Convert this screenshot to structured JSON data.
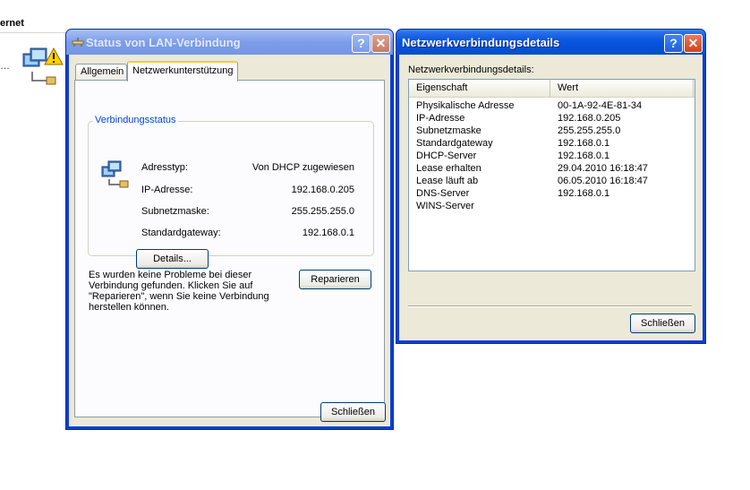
{
  "background": {
    "title": "ernet",
    "dots": "…"
  },
  "status_window": {
    "title": "Status von LAN-Verbindung",
    "tabs": [
      {
        "label": "Allgemein"
      },
      {
        "label": "Netzwerkunterstützung"
      }
    ],
    "group_label": "Verbindungsstatus",
    "rows": [
      {
        "label": "Adresstyp:",
        "value": "Von DHCP zugewiesen"
      },
      {
        "label": "IP-Adresse:",
        "value": "192.168.0.205"
      },
      {
        "label": "Subnetzmaske:",
        "value": "255.255.255.0"
      },
      {
        "label": "Standardgateway:",
        "value": "192.168.0.1"
      }
    ],
    "details_button": "Details...",
    "message": "Es wurden keine Probleme bei dieser Verbindung gefunden. Klicken Sie auf \"Reparieren\", wenn Sie keine Verbindung herstellen können.",
    "repair_button": "Reparieren",
    "close_button": "Schließen"
  },
  "details_window": {
    "title": "Netzwerkverbindungsdetails",
    "label": "Netzwerkverbindungsdetails:",
    "columns": [
      "Eigenschaft",
      "Wert"
    ],
    "rows": [
      {
        "property": "Physikalische Adresse",
        "value": "00-1A-92-4E-81-34"
      },
      {
        "property": "IP-Adresse",
        "value": "192.168.0.205"
      },
      {
        "property": "Subnetzmaske",
        "value": "255.255.255.0"
      },
      {
        "property": "Standardgateway",
        "value": "192.168.0.1"
      },
      {
        "property": "DHCP-Server",
        "value": "192.168.0.1"
      },
      {
        "property": "Lease erhalten",
        "value": "29.04.2010 16:18:47"
      },
      {
        "property": "Lease läuft ab",
        "value": "06.05.2010 16:18:47"
      },
      {
        "property": "DNS-Server",
        "value": "192.168.0.1"
      },
      {
        "property": "WINS-Server",
        "value": ""
      }
    ],
    "close_button": "Schließen"
  },
  "titlebar_buttons": {
    "help": "?",
    "close": "✕"
  },
  "colors": {
    "titlebar_active": "#0a58e0",
    "titlebar_inactive": "#7d9de8",
    "dialog_face": "#ece9d8",
    "group_label": "#0046d5",
    "tab_highlight": "#ffc83c"
  }
}
